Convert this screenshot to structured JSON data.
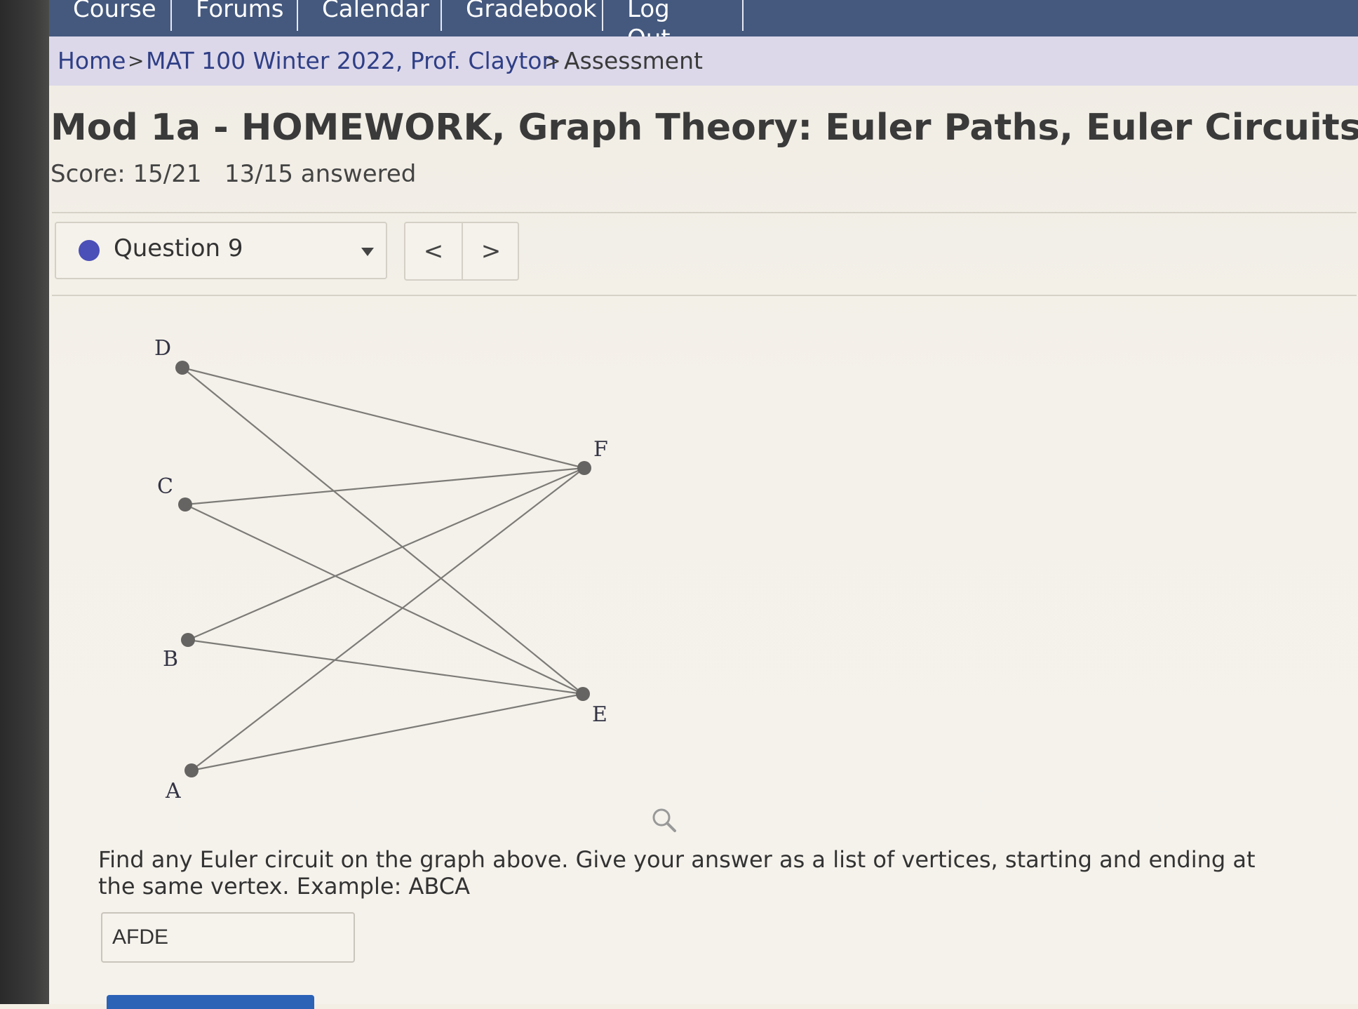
{
  "nav": {
    "items": [
      {
        "label": "Course",
        "x": 0
      },
      {
        "label": "Forums",
        "x": 1
      },
      {
        "label": "Calendar",
        "x": 2
      },
      {
        "label": "Gradebook",
        "x": 3
      },
      {
        "label": "Log Out",
        "x": 4
      }
    ]
  },
  "breadcrumb": {
    "home": "Home",
    "course": "MAT 100 Winter 2022, Prof. Clayton",
    "current": "Assessment",
    "separator": ">"
  },
  "assessment": {
    "title": "Mod 1a - HOMEWORK, Graph Theory: Euler Paths, Euler Circuits",
    "score": "Score: 15/21",
    "answered": "13/15 answered"
  },
  "question_nav": {
    "selected": "Question 9",
    "prev_symbol": "<",
    "next_symbol": ">"
  },
  "graph": {
    "vertices": [
      "D",
      "C",
      "B",
      "A",
      "F",
      "E"
    ],
    "edges": [
      [
        "D",
        "F"
      ],
      [
        "D",
        "E"
      ],
      [
        "C",
        "F"
      ],
      [
        "C",
        "E"
      ],
      [
        "B",
        "F"
      ],
      [
        "B",
        "E"
      ],
      [
        "A",
        "F"
      ],
      [
        "A",
        "E"
      ]
    ]
  },
  "question": {
    "prompt": "Find any Euler circuit on the graph above. Give your answer as a list of vertices, starting and ending at the same vertex. Example: ABCA",
    "answer_value": "AFDE"
  },
  "colors": {
    "nav_bg": "#45597e",
    "breadcrumb_bg": "#dcd8ea",
    "link": "#2f3f86",
    "question_dot": "#4b4fb8"
  }
}
